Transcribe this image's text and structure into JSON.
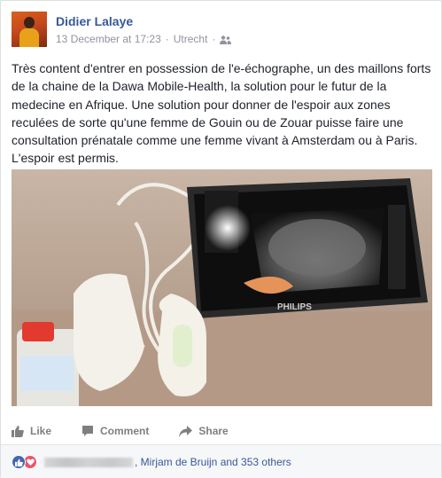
{
  "post": {
    "author": "Didier Lalaye",
    "date": "13 December at 17:23",
    "location": "Utrecht",
    "audience_icon": "friends-icon",
    "text": "Très content d'entrer en possession de l'e-échographe, un des maillons forts de la chaine de la Dawa Mobile-Health, la solution pour le futur de la medecine en Afrique. Une solution pour donner de l'espoir aux zones reculées de sorte qu'une femme de Gouin ou de Zouar puisse faire une consultation prénatale comme une femme vivant à Amsterdam ou à Paris. L'espoir est permis.",
    "photo": {
      "brand_label": "PHILIPS"
    }
  },
  "actions": {
    "like": "Like",
    "comment": "Comment",
    "share": "Share"
  },
  "reactions": {
    "names_text": ", Mirjam de Bruijn and 353 others",
    "icons": [
      "like-icon",
      "love-icon"
    ]
  },
  "colors": {
    "link": "#365899",
    "meta": "#90949c",
    "text": "#1d2129",
    "like_blue": "#4267b2",
    "love_red": "#f25268"
  }
}
